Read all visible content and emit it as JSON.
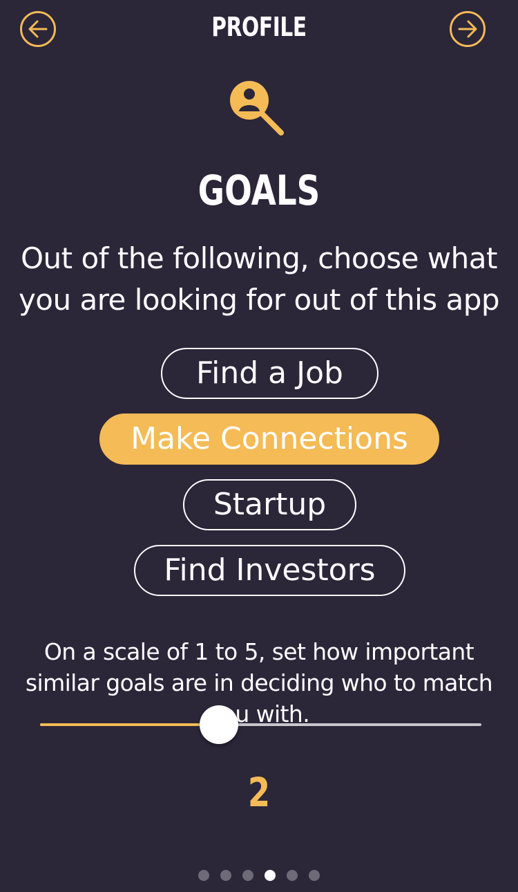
{
  "header": {
    "title": "PROFILE",
    "back_icon": "arrow-left-circle-icon",
    "forward_icon": "arrow-right-circle-icon"
  },
  "section": {
    "icon": "user-search-icon",
    "title": "GOALS",
    "prompt": "Out of the following, choose what you are looking for out of this app"
  },
  "options": [
    {
      "label": "Find a Job",
      "selected": false
    },
    {
      "label": "Make Connections",
      "selected": true
    },
    {
      "label": "Startup",
      "selected": false
    },
    {
      "label": "Find Investors",
      "selected": false
    }
  ],
  "importance": {
    "text": "On a scale of 1 to 5, set how important similar goals are in deciding who to match you with.",
    "min": 1,
    "max": 5,
    "value": "2",
    "slider_fraction": 0.406
  },
  "pagination": {
    "count": 6,
    "active_index": 3
  },
  "colors": {
    "background": "#2c2639",
    "accent": "#f4bb56",
    "text": "#ffffff",
    "track": "#c6c6cc",
    "dot_inactive": "#6e6a78"
  }
}
